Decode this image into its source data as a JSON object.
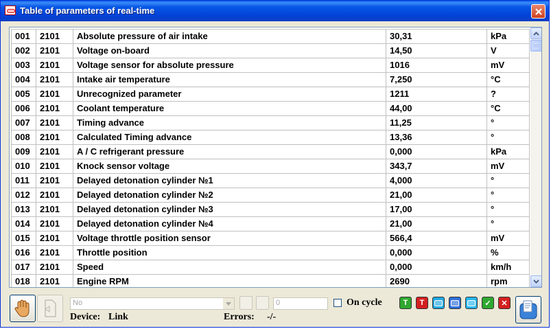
{
  "window": {
    "title": "Table of parameters of real-time"
  },
  "table": {
    "rows": [
      {
        "num": "001",
        "block": "2101",
        "name": "Absolute pressure of air intake",
        "value": "30,31",
        "unit": "kPa"
      },
      {
        "num": "002",
        "block": "2101",
        "name": "Voltage on-board",
        "value": "14,50",
        "unit": "V"
      },
      {
        "num": "003",
        "block": "2101",
        "name": "Voltage sensor for absolute pressure",
        "value": "1016",
        "unit": "mV"
      },
      {
        "num": "004",
        "block": "2101",
        "name": "Intake air temperature",
        "value": "7,250",
        "unit": "°C"
      },
      {
        "num": "005",
        "block": "2101",
        "name": "Unrecognized parameter",
        "value": "1211",
        "unit": "?"
      },
      {
        "num": "006",
        "block": "2101",
        "name": "Coolant temperature",
        "value": "44,00",
        "unit": "°C"
      },
      {
        "num": "007",
        "block": "2101",
        "name": "Timing advance",
        "value": "11,25",
        "unit": "°"
      },
      {
        "num": "008",
        "block": "2101",
        "name": "Calculated Timing advance",
        "value": "13,36",
        "unit": "°"
      },
      {
        "num": "009",
        "block": "2101",
        "name": "A / C refrigerant pressure",
        "value": "0,000",
        "unit": "kPa"
      },
      {
        "num": "010",
        "block": "2101",
        "name": "Knock sensor voltage",
        "value": "343,7",
        "unit": "mV"
      },
      {
        "num": "011",
        "block": "2101",
        "name": "Delayed detonation cylinder №1",
        "value": "4,000",
        "unit": "°"
      },
      {
        "num": "012",
        "block": "2101",
        "name": "Delayed detonation cylinder №2",
        "value": "21,00",
        "unit": "°"
      },
      {
        "num": "013",
        "block": "2101",
        "name": "Delayed detonation cylinder №3",
        "value": "17,00",
        "unit": "°"
      },
      {
        "num": "014",
        "block": "2101",
        "name": "Delayed detonation cylinder №4",
        "value": "21,00",
        "unit": "°"
      },
      {
        "num": "015",
        "block": "2101",
        "name": "Voltage throttle position sensor",
        "value": "566,4",
        "unit": "mV"
      },
      {
        "num": "016",
        "block": "2101",
        "name": "Throttle position",
        "value": "0,000",
        "unit": "%"
      },
      {
        "num": "017",
        "block": "2101",
        "name": "Speed",
        "value": "0,000",
        "unit": "km/h"
      },
      {
        "num": "018",
        "block": "2101",
        "name": "Engine RPM",
        "value": "2690",
        "unit": "rpm"
      }
    ]
  },
  "toolbar": {
    "select_value": "No",
    "number_value": "0",
    "on_cycle_label": "On cycle",
    "on_cycle_checked": false,
    "device_label": "Device:",
    "device_value": "Link",
    "errors_label": "Errors:",
    "errors_value": "-/-",
    "tools": [
      {
        "icon": "green-t-icon",
        "glyph": "T",
        "color": "#2fa82f"
      },
      {
        "icon": "red-t-icon",
        "glyph": "T",
        "color": "#d42020"
      },
      {
        "icon": "cyan-list-icon",
        "glyph": "",
        "color": "#1fa7e0"
      },
      {
        "icon": "blue-list-icon",
        "glyph": "",
        "color": "#2f6fd8"
      },
      {
        "icon": "cyan-rect-icon",
        "glyph": "",
        "color": "#25b5ee"
      },
      {
        "icon": "green-check-icon",
        "glyph": "✓",
        "color": "#2fa82f"
      },
      {
        "icon": "red-x-icon",
        "glyph": "✕",
        "color": "#d42020"
      }
    ]
  },
  "colors": {
    "title_bar": "#0a56e0",
    "close": "#d0431f",
    "grid": "#c0c0c0"
  }
}
